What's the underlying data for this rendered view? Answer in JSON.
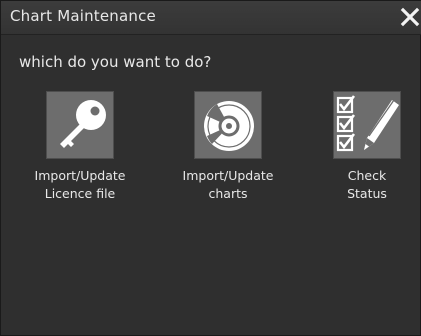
{
  "window": {
    "title": "Chart Maintenance",
    "close_icon": "close-icon"
  },
  "prompt": "which do you want to do?",
  "options": [
    {
      "label_line1": "Import/Update",
      "label_line2": "Licence file",
      "icon": "key-icon"
    },
    {
      "label_line1": "Import/Update",
      "label_line2": "charts",
      "icon": "disc-icon"
    },
    {
      "label_line1": "Check",
      "label_line2": "Status",
      "icon": "checklist-icon"
    }
  ],
  "colors": {
    "background": "#2f2f2f",
    "tile": "#6d6d6d",
    "text": "#e8e8e8"
  }
}
